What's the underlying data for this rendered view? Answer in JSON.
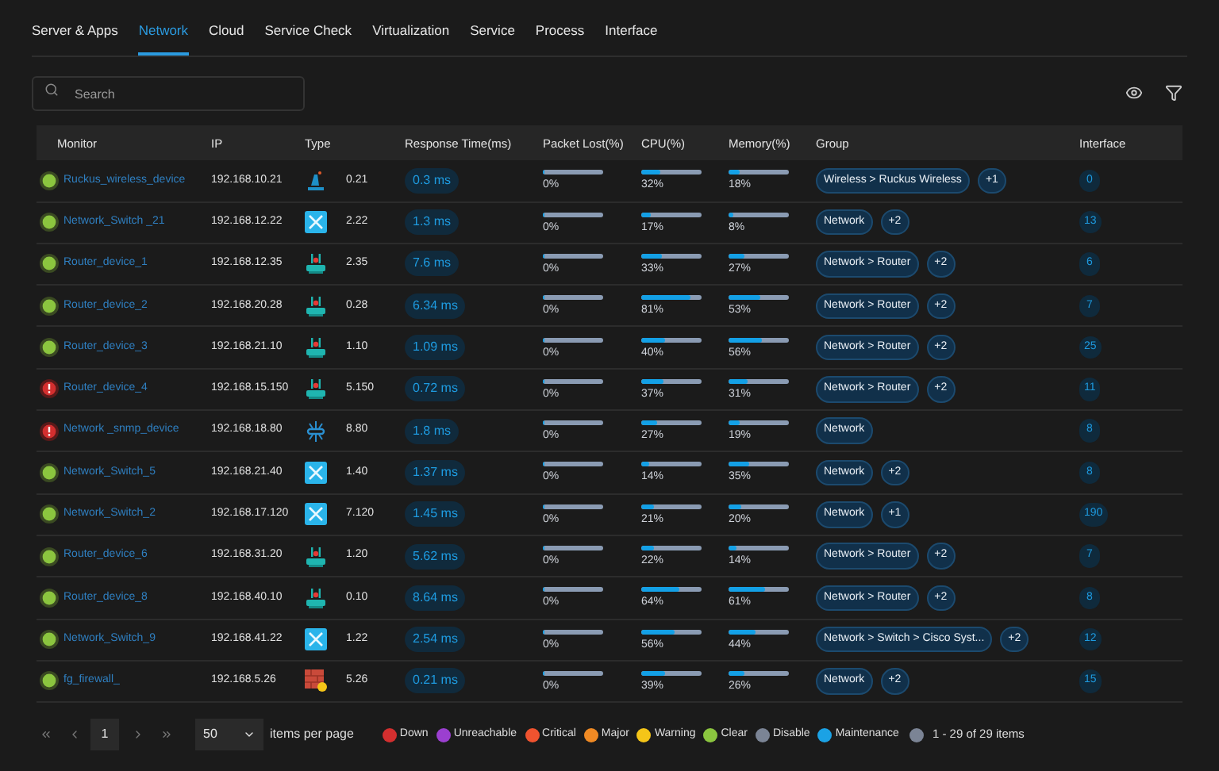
{
  "tabs": [
    {
      "label": "Server & Apps",
      "selected": false
    },
    {
      "label": "Network",
      "selected": true
    },
    {
      "label": "Cloud",
      "selected": false
    },
    {
      "label": "Service Check",
      "selected": false
    },
    {
      "label": "Virtualization",
      "selected": false
    },
    {
      "label": "Service",
      "selected": false
    },
    {
      "label": "Process",
      "selected": false
    },
    {
      "label": "Interface",
      "selected": false
    }
  ],
  "search": {
    "placeholder": "Search"
  },
  "table": {
    "columns": [
      "Monitor",
      "IP",
      "Type",
      "Response Time(ms)",
      "Packet Lost(%)",
      "CPU(%)",
      "Memory(%)",
      "Group",
      "Interface"
    ],
    "rows": [
      {
        "status": {
          "kind": "clear"
        },
        "monitor": "Ruckus_wireless_device",
        "ip": "192.168.10.21",
        "type": {
          "kind": "wireless",
          "text": "0.21"
        },
        "response": "0.3 ms",
        "packet": {
          "reading": "0%",
          "level": 0
        },
        "cpu": {
          "reading": "32%",
          "level": 0.32
        },
        "memory": {
          "reading": "18%",
          "level": 0.18
        },
        "groups": [
          "Wireless > Ruckus Wireless",
          "+1"
        ],
        "interface": "0"
      },
      {
        "status": {
          "kind": "clear"
        },
        "monitor": "Network_Switch _21",
        "ip": "192.168.12.22",
        "type": {
          "kind": "switch",
          "text": "2.22"
        },
        "response": "1.3 ms",
        "packet": {
          "reading": "0%",
          "level": 0
        },
        "cpu": {
          "reading": "17%",
          "level": 0.17
        },
        "memory": {
          "reading": "8%",
          "level": 0.08
        },
        "groups": [
          "Network",
          "+2"
        ],
        "interface": "13"
      },
      {
        "status": {
          "kind": "clear"
        },
        "monitor": "Router_device_1",
        "ip": "192.168.12.35",
        "type": {
          "kind": "router",
          "text": "2.35"
        },
        "response": "7.6 ms",
        "packet": {
          "reading": "0%",
          "level": 0
        },
        "cpu": {
          "reading": "33%",
          "level": 0.33
        },
        "memory": {
          "reading": "27%",
          "level": 0.27
        },
        "groups": [
          "Network > Router",
          "+2"
        ],
        "interface": "6"
      },
      {
        "status": {
          "kind": "clear"
        },
        "monitor": "Router_device_2",
        "ip": "192.168.20.28",
        "type": {
          "kind": "router",
          "text": "0.28"
        },
        "response": "6.34 ms",
        "packet": {
          "reading": "0%",
          "level": 0
        },
        "cpu": {
          "reading": "81%",
          "level": 0.81
        },
        "memory": {
          "reading": "53%",
          "level": 0.53
        },
        "groups": [
          "Network > Router",
          "+2"
        ],
        "interface": "7"
      },
      {
        "status": {
          "kind": "clear"
        },
        "monitor": "Router_device_3",
        "ip": "192.168.21.10",
        "type": {
          "kind": "router",
          "text": "1.10"
        },
        "response": "1.09 ms",
        "packet": {
          "reading": "0%",
          "level": 0
        },
        "cpu": {
          "reading": "40%",
          "level": 0.4
        },
        "memory": {
          "reading": "56%",
          "level": 0.56
        },
        "groups": [
          "Network > Router",
          "+2"
        ],
        "interface": "25"
      },
      {
        "status": {
          "kind": "down"
        },
        "monitor": "Router_device_4",
        "ip": "192.168.15.150",
        "type": {
          "kind": "router",
          "text": "5.150"
        },
        "response": "0.72 ms",
        "packet": {
          "reading": "0%",
          "level": 0
        },
        "cpu": {
          "reading": "37%",
          "level": 0.37
        },
        "memory": {
          "reading": "31%",
          "level": 0.31
        },
        "groups": [
          "Network > Router",
          "+2"
        ],
        "interface": "11"
      },
      {
        "status": {
          "kind": "down"
        },
        "monitor": "Network _snmp_device",
        "ip": "192.168.18.80",
        "type": {
          "kind": "snmp",
          "text": "8.80"
        },
        "response": "1.8 ms",
        "packet": {
          "reading": "0%",
          "level": 0
        },
        "cpu": {
          "reading": "27%",
          "level": 0.27
        },
        "memory": {
          "reading": "19%",
          "level": 0.19
        },
        "groups": [
          "Network"
        ],
        "interface": "8"
      },
      {
        "status": {
          "kind": "clear"
        },
        "monitor": "Network_Switch_5",
        "ip": "192.168.21.40",
        "type": {
          "kind": "switch",
          "text": "1.40"
        },
        "response": "1.37 ms",
        "packet": {
          "reading": "0%",
          "level": 0
        },
        "cpu": {
          "reading": "14%",
          "level": 0.14
        },
        "memory": {
          "reading": "35%",
          "level": 0.35
        },
        "groups": [
          "Network",
          "+2"
        ],
        "interface": "8"
      },
      {
        "status": {
          "kind": "clear"
        },
        "monitor": "Network_Switch_2",
        "ip": "192.168.17.120",
        "type": {
          "kind": "switch",
          "text": "7.120"
        },
        "response": "1.45 ms",
        "packet": {
          "reading": "0%",
          "level": 0
        },
        "cpu": {
          "reading": "21%",
          "level": 0.21
        },
        "memory": {
          "reading": "20%",
          "level": 0.2
        },
        "groups": [
          "Network",
          "+1"
        ],
        "interface": "190"
      },
      {
        "status": {
          "kind": "clear"
        },
        "monitor": "Router_device_6",
        "ip": "192.168.31.20",
        "type": {
          "kind": "router",
          "text": "1.20"
        },
        "response": "5.62 ms",
        "packet": {
          "reading": "0%",
          "level": 0
        },
        "cpu": {
          "reading": "22%",
          "level": 0.22
        },
        "memory": {
          "reading": "14%",
          "level": 0.14
        },
        "groups": [
          "Network > Router",
          "+2"
        ],
        "interface": "7"
      },
      {
        "status": {
          "kind": "clear"
        },
        "monitor": "Router_device_8",
        "ip": "192.168.40.10",
        "type": {
          "kind": "router",
          "text": "0.10"
        },
        "response": "8.64 ms",
        "packet": {
          "reading": "0%",
          "level": 0
        },
        "cpu": {
          "reading": "64%",
          "level": 0.64
        },
        "memory": {
          "reading": "61%",
          "level": 0.61
        },
        "groups": [
          "Network > Router",
          "+2"
        ],
        "interface": "8"
      },
      {
        "status": {
          "kind": "clear"
        },
        "monitor": "Network_Switch_9",
        "ip": "192.168.41.22",
        "type": {
          "kind": "switch",
          "text": "1.22"
        },
        "response": "2.54 ms",
        "packet": {
          "reading": "0%",
          "level": 0
        },
        "cpu": {
          "reading": "56%",
          "level": 0.56
        },
        "memory": {
          "reading": "44%",
          "level": 0.44
        },
        "groups": [
          "Network > Switch > Cisco Syst...",
          "+2"
        ],
        "interface": "12"
      },
      {
        "status": {
          "kind": "clear"
        },
        "monitor": "fg_firewall_",
        "ip": "192.168.5.26",
        "type": {
          "kind": "firewall",
          "text": "5.26"
        },
        "response": "0.21 ms",
        "packet": {
          "reading": "0%",
          "level": 0
        },
        "cpu": {
          "reading": "39%",
          "level": 0.39
        },
        "memory": {
          "reading": "26%",
          "level": 0.26
        },
        "groups": [
          "Network",
          "+2"
        ],
        "interface": "15"
      }
    ]
  },
  "pagination": {
    "page": "1",
    "page_size": "50",
    "per_page_label": "items per page",
    "summary": "1 - 29 of 29 items"
  },
  "legend": [
    {
      "label": "Down",
      "color": "#d32f2f"
    },
    {
      "label": "Unreachable",
      "color": "#9b3fd0"
    },
    {
      "label": "Critical",
      "color": "#f0532f"
    },
    {
      "label": "Major",
      "color": "#f08a24"
    },
    {
      "label": "Warning",
      "color": "#f5c518"
    },
    {
      "label": "Clear",
      "color": "#8bc53f"
    },
    {
      "label": "Disable",
      "color": "#7b8495"
    },
    {
      "label": "Maintenance",
      "color": "#1ba2e5"
    }
  ]
}
